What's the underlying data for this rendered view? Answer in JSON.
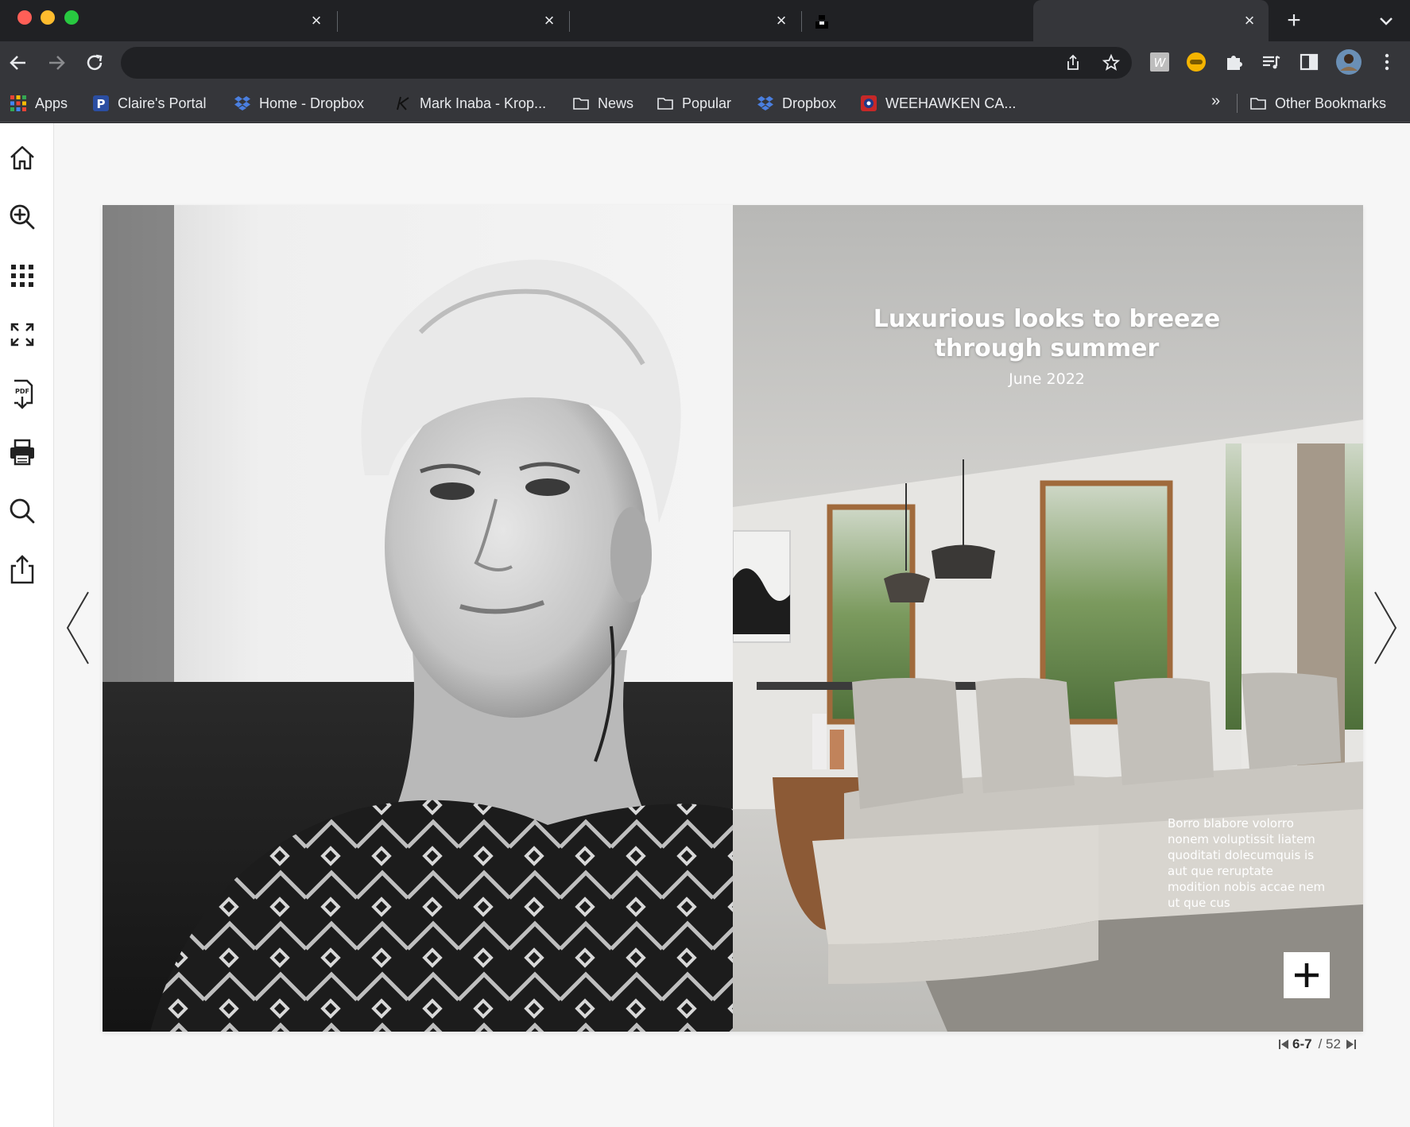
{
  "tabs": [
    {
      "title": "",
      "active": false
    },
    {
      "title": "",
      "active": false
    },
    {
      "title": "",
      "active": false
    },
    {
      "title": "",
      "active": false
    },
    {
      "title": "",
      "active": true
    }
  ],
  "bookmarks": {
    "items": [
      {
        "label": "Apps",
        "icon": "apps-grid-icon"
      },
      {
        "label": "Claire's Portal",
        "icon": "portal-icon"
      },
      {
        "label": "Home - Dropbox",
        "icon": "dropbox-icon"
      },
      {
        "label": "Mark Inaba - Krop...",
        "icon": "krop-icon"
      },
      {
        "label": "News",
        "icon": "folder-icon"
      },
      {
        "label": "Popular",
        "icon": "folder-icon"
      },
      {
        "label": "Dropbox",
        "icon": "dropbox-icon"
      },
      {
        "label": "WEEHAWKEN CA...",
        "icon": "weehawken-icon"
      }
    ],
    "overflow": "»",
    "other": "Other Bookmarks"
  },
  "omnibox": {
    "value": ""
  },
  "sidebar": {
    "tools": [
      "home-icon",
      "zoom-in-icon",
      "grid-icon",
      "fullscreen-icon",
      "pdf-download-icon",
      "print-icon",
      "search-icon",
      "share-icon"
    ]
  },
  "magazine": {
    "headline": "Luxurious looks to breeze through summer",
    "date": "June 2022",
    "body": "Borro blabore volorro nonem voluptissit liatem quoditati dolecumquis is aut que reruptate modition nobis accae nem ut que cus"
  },
  "pager": {
    "current": "6-7",
    "total": "/ 52"
  },
  "colors": {
    "chrome_dark": "#202124",
    "chrome_bar": "#35363a",
    "page_bg": "#f6f6f6",
    "accent_text": "#ffffff"
  }
}
